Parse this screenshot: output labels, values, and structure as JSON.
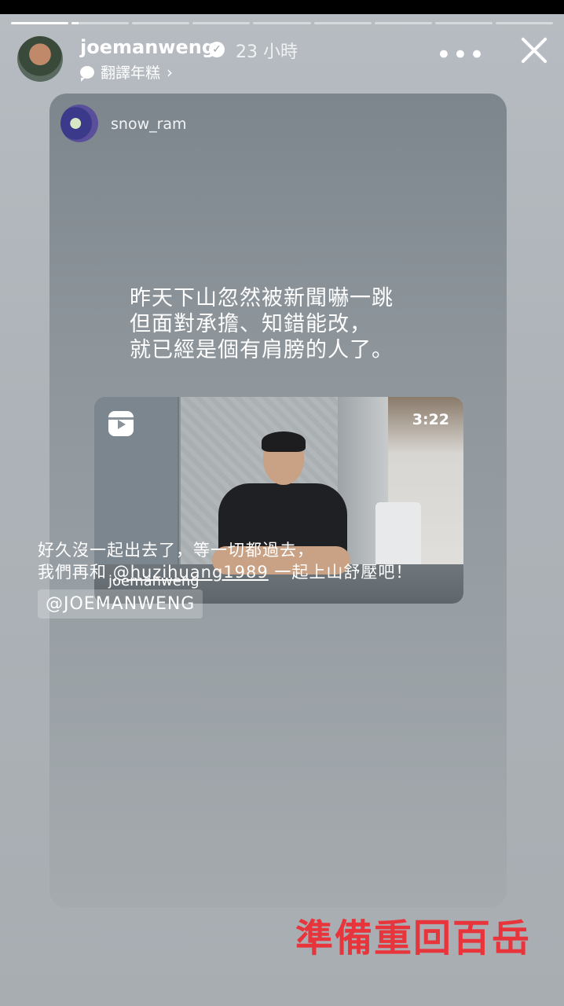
{
  "story": {
    "progress_segments": 9,
    "active_segment_progress": 1
  },
  "header": {
    "username": "joemanweng",
    "time": "23 小時",
    "translate_label": "翻譯年糕"
  },
  "shared_post": {
    "username": "snow_ram",
    "text_line1": "昨天下山忽然被新聞嚇一跳",
    "text_line2": "但面對承擔、知錯能改，",
    "text_line3": "就已經是個有肩膀的人了。",
    "reel": {
      "duration": "3:22",
      "username": "joemanweng"
    },
    "caption_line1": "好久沒一起出去了，等一切都過去，",
    "caption_line2_prefix": "我們再和 ",
    "caption_mention": "@huzihuang1989",
    "caption_line2_suffix": " 一起上山舒壓吧！",
    "tag": "@JOEMANWENG"
  },
  "overlay_text": "準備重回百岳"
}
